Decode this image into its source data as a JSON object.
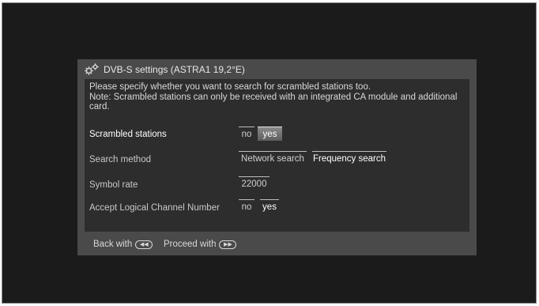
{
  "dialog": {
    "title": "DVB-S settings (ASTRA1 19,2°E)",
    "title_icon": "gears-icon",
    "description_line1": "Please specify whether you want to search for scrambled stations too.",
    "description_line2": "Note: Scrambled stations can only be received with an integrated CA module and additional card."
  },
  "rows": {
    "scrambled": {
      "label": "Scrambled stations",
      "options": [
        "no",
        "yes"
      ],
      "selected": "yes"
    },
    "search_method": {
      "label": "Search method",
      "options": [
        "Network search",
        "Frequency search"
      ],
      "selected": "Frequency search"
    },
    "symbol_rate": {
      "label": "Symbol rate",
      "value": "22000"
    },
    "lcn": {
      "label": "Accept Logical Channel Number",
      "options": [
        "no",
        "yes"
      ],
      "selected": "yes"
    }
  },
  "footer": {
    "back_label": "Back with",
    "back_icon": "rewind-key-icon",
    "proceed_label": "Proceed with",
    "proceed_icon": "fast-forward-key-icon"
  },
  "colors": {
    "screen_bg": "#1b1b1b",
    "dialog_bg": "#4a4a4a",
    "panel_bg": "#2d2d2d",
    "highlight": "#7a7a7a"
  }
}
